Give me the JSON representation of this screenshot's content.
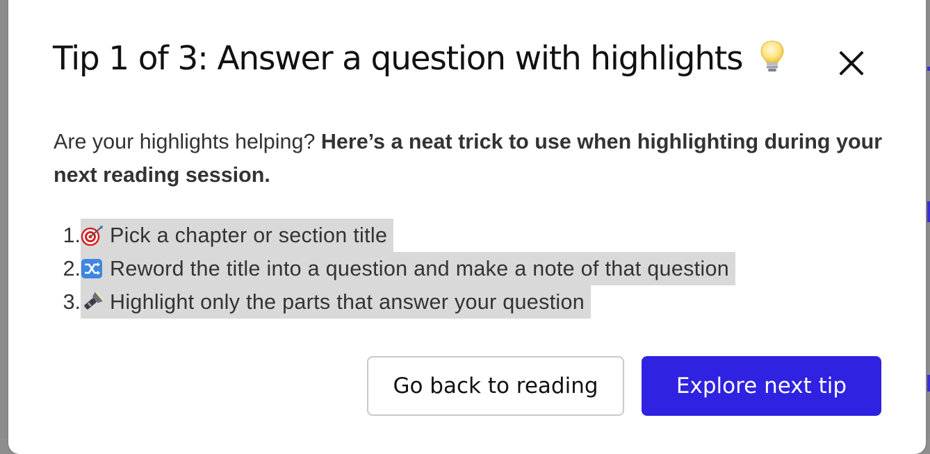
{
  "dialog": {
    "title": "Tip 1 of 3: Answer a question with highlights",
    "title_icon": "lightbulb-icon",
    "close_icon": "close-icon",
    "intro_regular": "Are your highlights helping? ",
    "intro_bold": "Here’s a neat trick to use when highlighting during your next reading session.",
    "steps": [
      {
        "number": "1.",
        "icon": "target-icon",
        "text": "Pick a chapter or section title"
      },
      {
        "number": "2.",
        "icon": "shuffle-icon",
        "text": "Reword the title into a question and make a note of that question"
      },
      {
        "number": "3.",
        "icon": "flashlight-icon",
        "text": "Highlight only the parts that answer your question"
      }
    ],
    "buttons": {
      "back_label": "Go back to reading",
      "next_label": "Explore next tip"
    }
  },
  "colors": {
    "accent": "#2f22e0",
    "highlight": "#d9d9d9",
    "backdrop": "#8c8c8c"
  }
}
